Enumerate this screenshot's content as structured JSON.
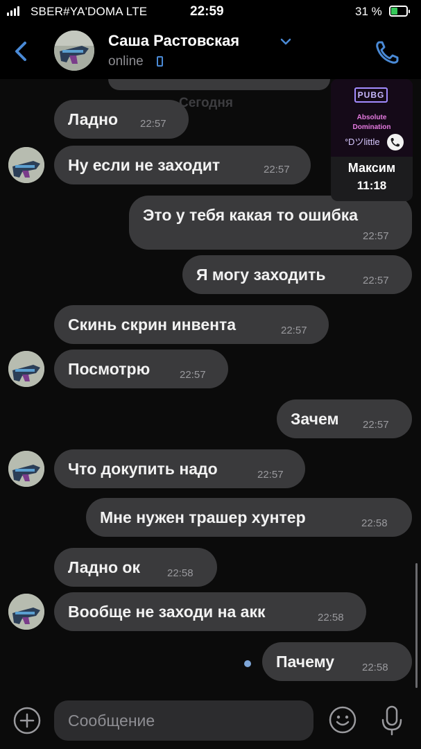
{
  "status_bar": {
    "carrier": "SBER#YA'DOMA  LTE",
    "time": "22:59",
    "battery": "31 %"
  },
  "header": {
    "contact_name": "Саша Растовская",
    "status": "online"
  },
  "chat": {
    "date_separator": "Сегодня",
    "messages": [
      {
        "text": "Ладно",
        "time": "22:57",
        "direction": "in"
      },
      {
        "text": "Ну если не заходит",
        "time": "22:57",
        "direction": "in"
      },
      {
        "text": "Это у тебя какая то ошибка",
        "time": "22:57",
        "direction": "out"
      },
      {
        "text": "Я могу заходить",
        "time": "22:57",
        "direction": "out"
      },
      {
        "text": "Скинь скрин инвента",
        "time": "22:57",
        "direction": "in"
      },
      {
        "text": "Посмотрю",
        "time": "22:57",
        "direction": "in"
      },
      {
        "text": "Зачем",
        "time": "22:57",
        "direction": "out"
      },
      {
        "text": "Что докупить надо",
        "time": "22:57",
        "direction": "in"
      },
      {
        "text": "Мне нужен трашер хунтер",
        "time": "22:58",
        "direction": "out"
      },
      {
        "text": "Ладно ок",
        "time": "22:58",
        "direction": "in"
      },
      {
        "text": "Вообще не заходи на акк",
        "time": "22:58",
        "direction": "in"
      },
      {
        "text": "Пачему",
        "time": "22:58",
        "direction": "out"
      }
    ]
  },
  "call_pip": {
    "logo": "PUBG",
    "art_line1": "Absolute",
    "art_line2": "Domination",
    "art_line3": "ᐤDツlittle",
    "caller": "Максим",
    "duration": "11:18"
  },
  "composer": {
    "placeholder": "Сообщение"
  },
  "colors": {
    "accent": "#4a8ad6",
    "bubble": "#3a3a3c",
    "background": "#0b0b0b"
  }
}
